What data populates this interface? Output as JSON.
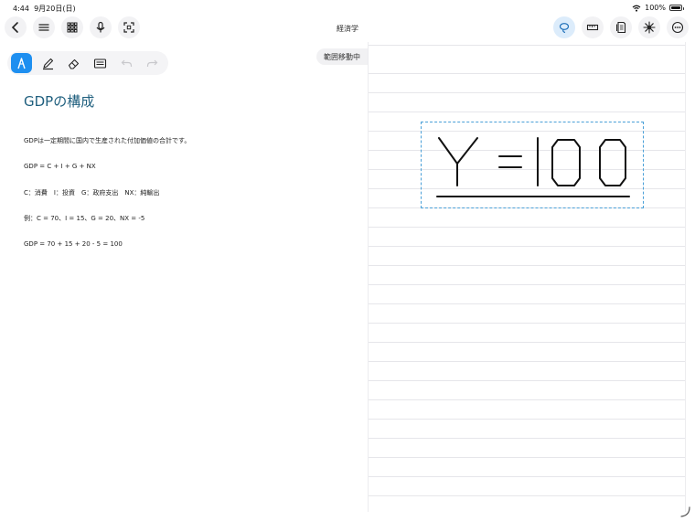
{
  "status_bar": {
    "time": "4:44",
    "date": "9月20日(日)",
    "battery_text": "100%",
    "battery_level": 1.0
  },
  "nav": {
    "title": "経済学",
    "left_icons": [
      "back-chevron-icon",
      "menu-lines-icon",
      "grid-icon",
      "microphone-icon",
      "scan-icon"
    ],
    "right_icons": [
      "lasso-icon",
      "ruler-icon",
      "page-icon",
      "laser-icon",
      "more-icon"
    ]
  },
  "toolbar": {
    "active_tool": "pen",
    "tools": [
      "pen-icon",
      "highlighter-icon",
      "eraser-icon",
      "keyboard-icon",
      "undo-icon",
      "redo-icon"
    ],
    "accent": "#1e8ff0"
  },
  "range_chip": {
    "label": "範囲移動中"
  },
  "note": {
    "title": "GDPの構成",
    "lines": [
      "GDPは一定期間に国内で生産された付加価値の合計です。",
      "GDP = C + I + G + NX",
      "C：消費　I：投資　G：政府支出　NX：純輸出",
      "例：C = 70、I = 15、G = 20、NX = -5",
      "GDP = 70 + 15 + 20 - 5 = 100"
    ]
  },
  "colors": {
    "title": "#1f5f7e",
    "selection": "#4aa0d8"
  }
}
